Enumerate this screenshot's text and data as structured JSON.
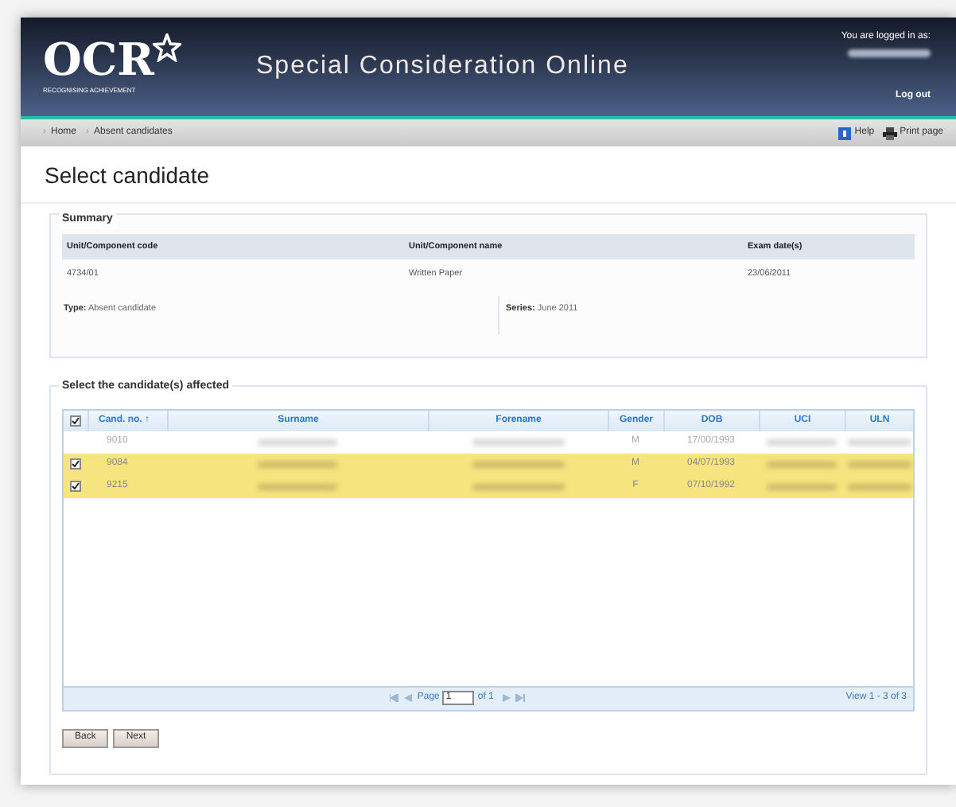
{
  "header": {
    "logo": "OCR",
    "logo_tagline": "RECOGNISING ACHIEVEMENT",
    "title": "Special Consideration Online",
    "login_label": "You are logged in as:",
    "username_redacted": true,
    "logout": "Log out"
  },
  "breadcrumb": [
    {
      "separator": "›",
      "label": "Home"
    },
    {
      "separator": "›",
      "label": "Absent candidates"
    }
  ],
  "toolbar": [
    {
      "kind": "help",
      "label": "Help"
    },
    {
      "kind": "print",
      "label": "Print page"
    }
  ],
  "page_title": "Select candidate",
  "summary": {
    "legend": "Summary",
    "columns": [
      "Unit/Component code",
      "Unit/Component name",
      "Exam date(s)"
    ],
    "row": [
      "4734/01",
      "Written Paper",
      "23/06/2011"
    ],
    "type_label": "Type:",
    "type_value": "Absent candidate",
    "series_label": "Series:",
    "series_value": "June 2011"
  },
  "candidates": {
    "legend": "Select the candidate(s) affected",
    "all_checked": true,
    "columns": [
      "Cand. no. ↑",
      "Surname",
      "Forename",
      "Gender",
      "DOB",
      "UCI",
      "ULN"
    ],
    "rows": [
      {
        "cand_no": "9010",
        "gender": "M",
        "dob": "17/00/1993",
        "redacted": true,
        "selected": false,
        "checked": false
      },
      {
        "cand_no": "9084",
        "gender": "M",
        "dob": "04/07/1993",
        "redacted": true,
        "selected": true,
        "checked": true
      },
      {
        "cand_no": "9215",
        "gender": "F",
        "dob": "07/10/1992",
        "redacted": true,
        "selected": true,
        "checked": true
      }
    ],
    "pager": {
      "page_label": "Page",
      "page_value": "1",
      "of_label": "of 1",
      "view": "View 1 - 3 of 3"
    }
  },
  "buttons": [
    "Back",
    "Next"
  ]
}
